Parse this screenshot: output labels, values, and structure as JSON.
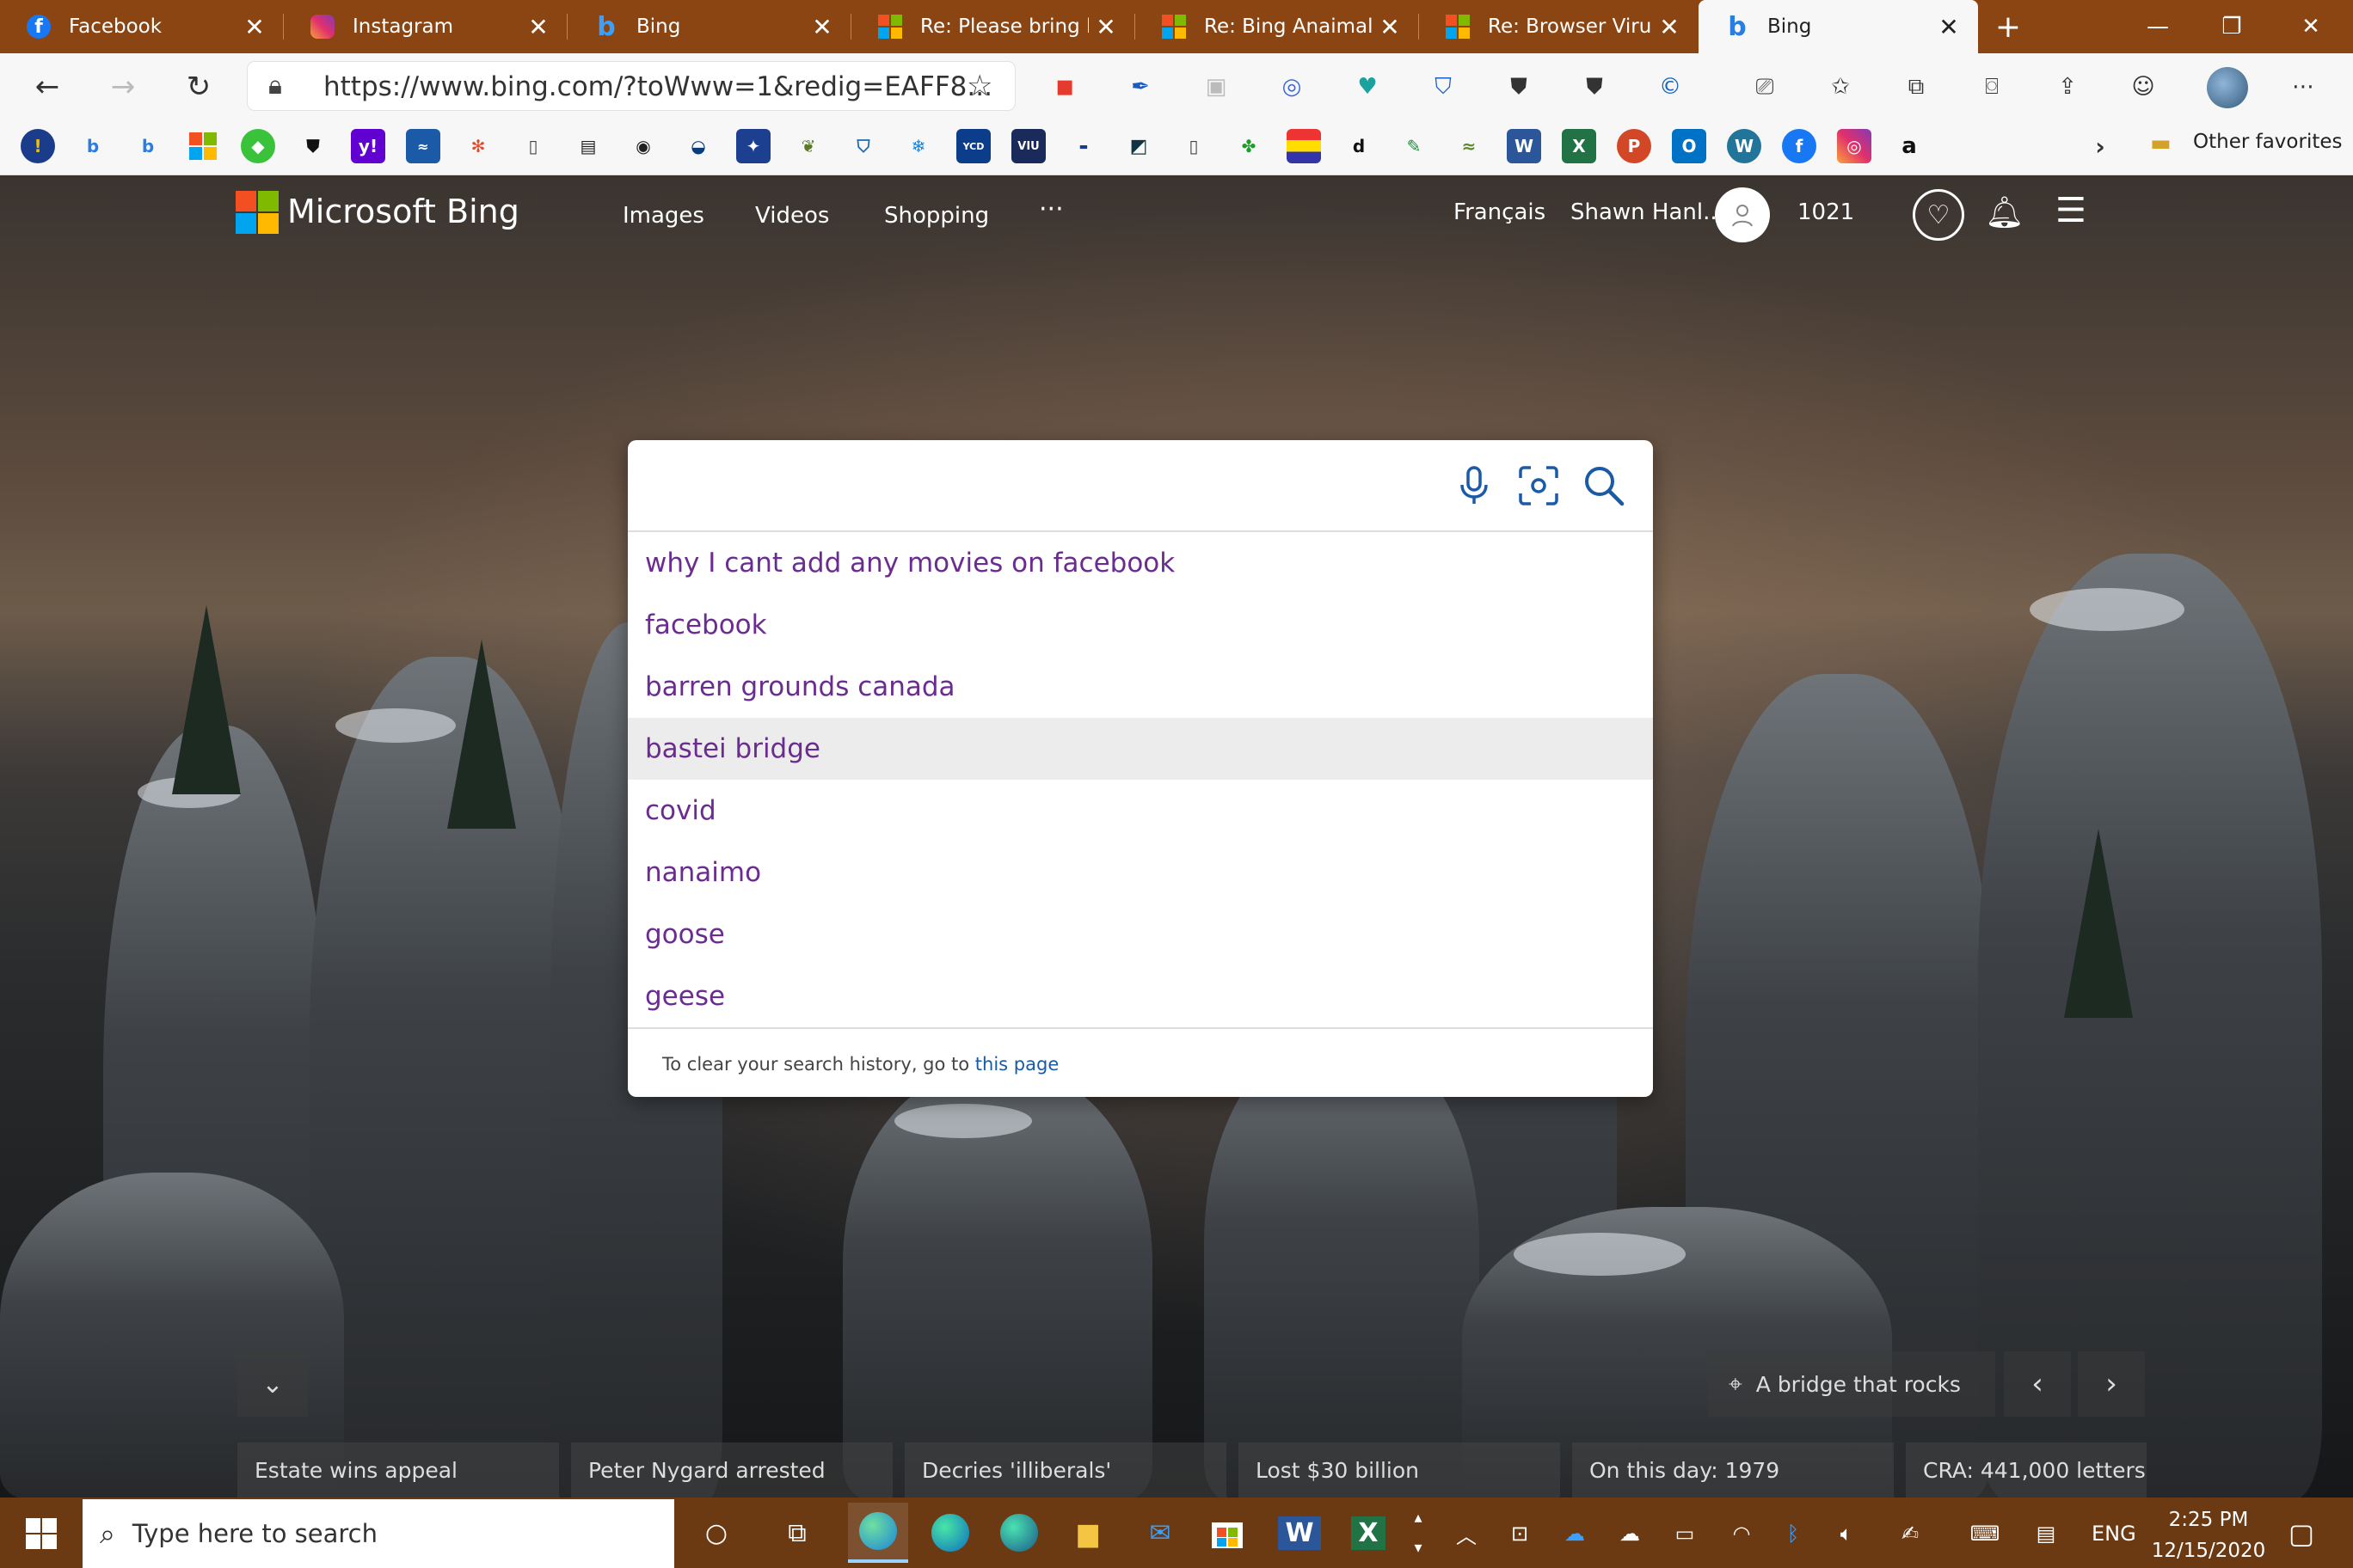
{
  "tabs": [
    {
      "label": "Facebook"
    },
    {
      "label": "Instagram"
    },
    {
      "label": "Bing"
    },
    {
      "label": "Re: Please bring ba"
    },
    {
      "label": "Re: Bing Anaimals"
    },
    {
      "label": "Re: Browser Virus I"
    },
    {
      "label": "Bing"
    }
  ],
  "address": {
    "url": "https://www.bing.com/?toWww=1&redig=EAFF8..."
  },
  "favorites": {
    "other": "Other favorites"
  },
  "bing": {
    "brand": "Microsoft Bing",
    "nav": [
      "Images",
      "Videos",
      "Shopping",
      "···"
    ],
    "language": "Français",
    "user": "Shawn Hanl...",
    "points": "1021"
  },
  "search": {
    "value": "",
    "suggestions": [
      "why I cant add any movies on facebook",
      "facebook",
      "barren grounds canada",
      "bastei bridge",
      "covid",
      "nanaimo",
      "goose",
      "geese"
    ],
    "clear_note": "To clear your search history, go to",
    "clear_link": "this page"
  },
  "image_info": {
    "caption": "A bridge that rocks"
  },
  "news": [
    "Estate wins appeal",
    "Peter Nygard arrested",
    "Decries 'illiberals'",
    "Lost $30 billion",
    "On this day: 1979",
    "CRA: 441,000 letters"
  ],
  "taskbar": {
    "search_placeholder": "Type here to search",
    "language": "ENG",
    "time": "2:25 PM",
    "date": "12/15/2020"
  },
  "colors": {
    "suggestion": "#6b2c91",
    "link": "#1a5aa6",
    "titlebar": "#8b4513"
  }
}
